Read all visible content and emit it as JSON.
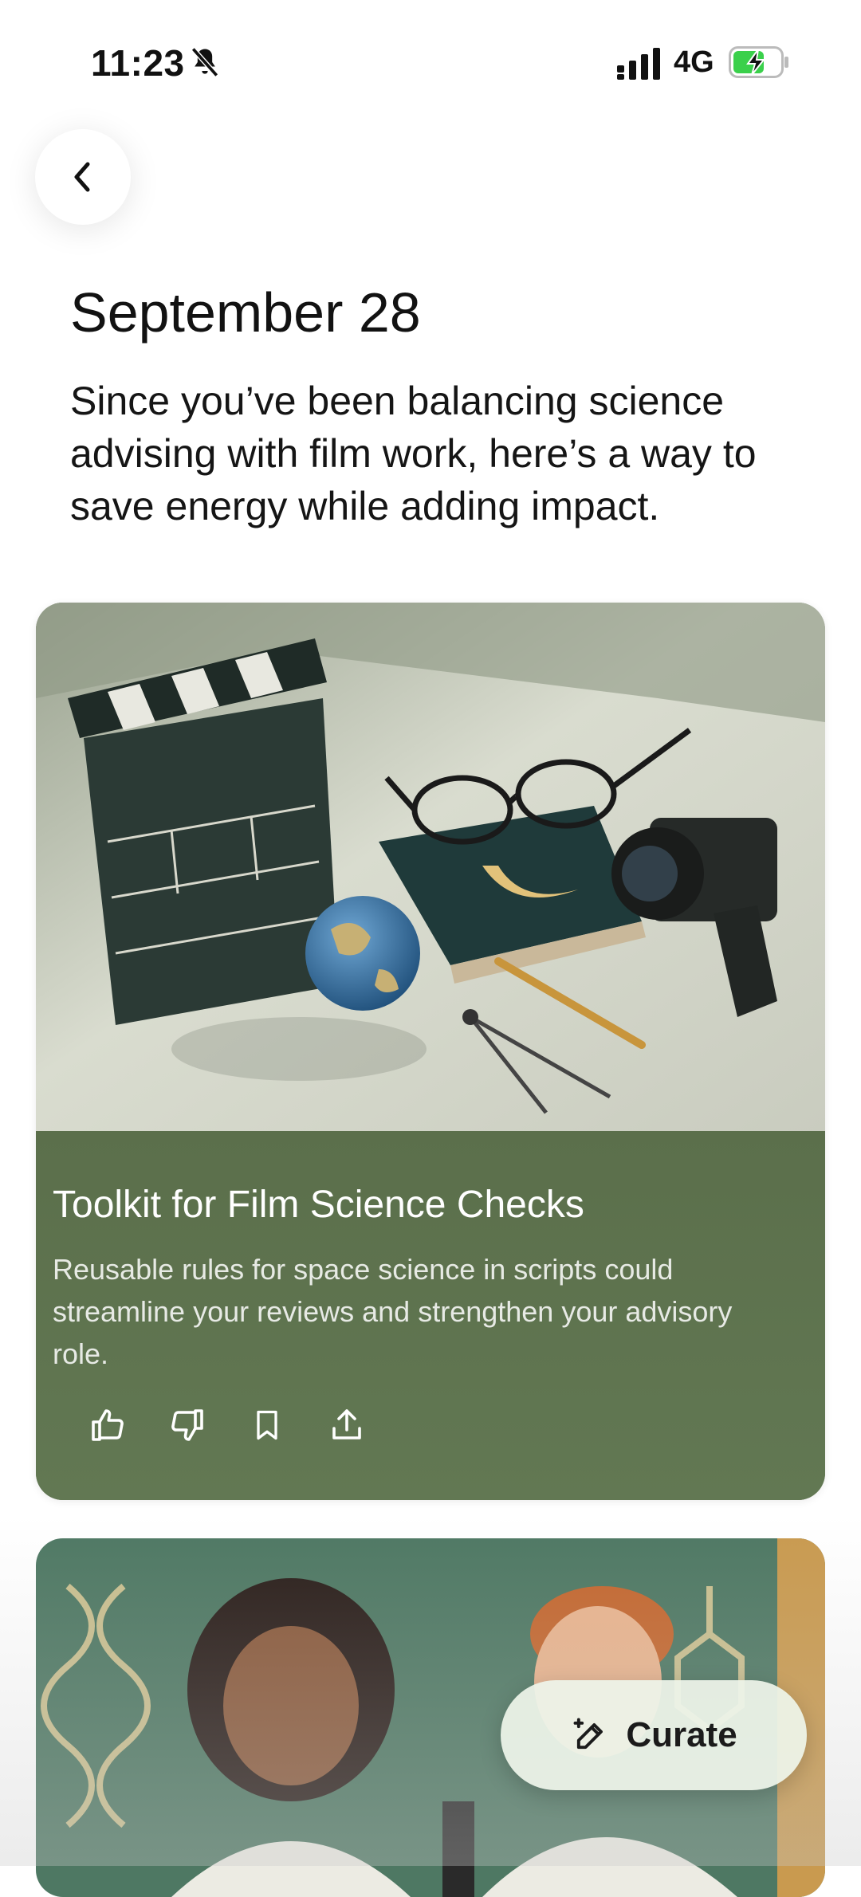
{
  "status_bar": {
    "time": "11:23",
    "network": "4G"
  },
  "header": {
    "date": "September 28",
    "intro": "Since you’ve been balancing science advising with film work, here’s a way to save energy while adding impact."
  },
  "card": {
    "title": "Toolkit for Film Science Checks",
    "description": "Reusable rules for space science in scripts could streamline your reviews and strengthen your advisory role.",
    "actions": [
      "thumbs-up-icon",
      "thumbs-down-icon",
      "bookmark-icon",
      "share-icon"
    ],
    "accent": "#617650"
  },
  "fab": {
    "label": "Curate"
  }
}
